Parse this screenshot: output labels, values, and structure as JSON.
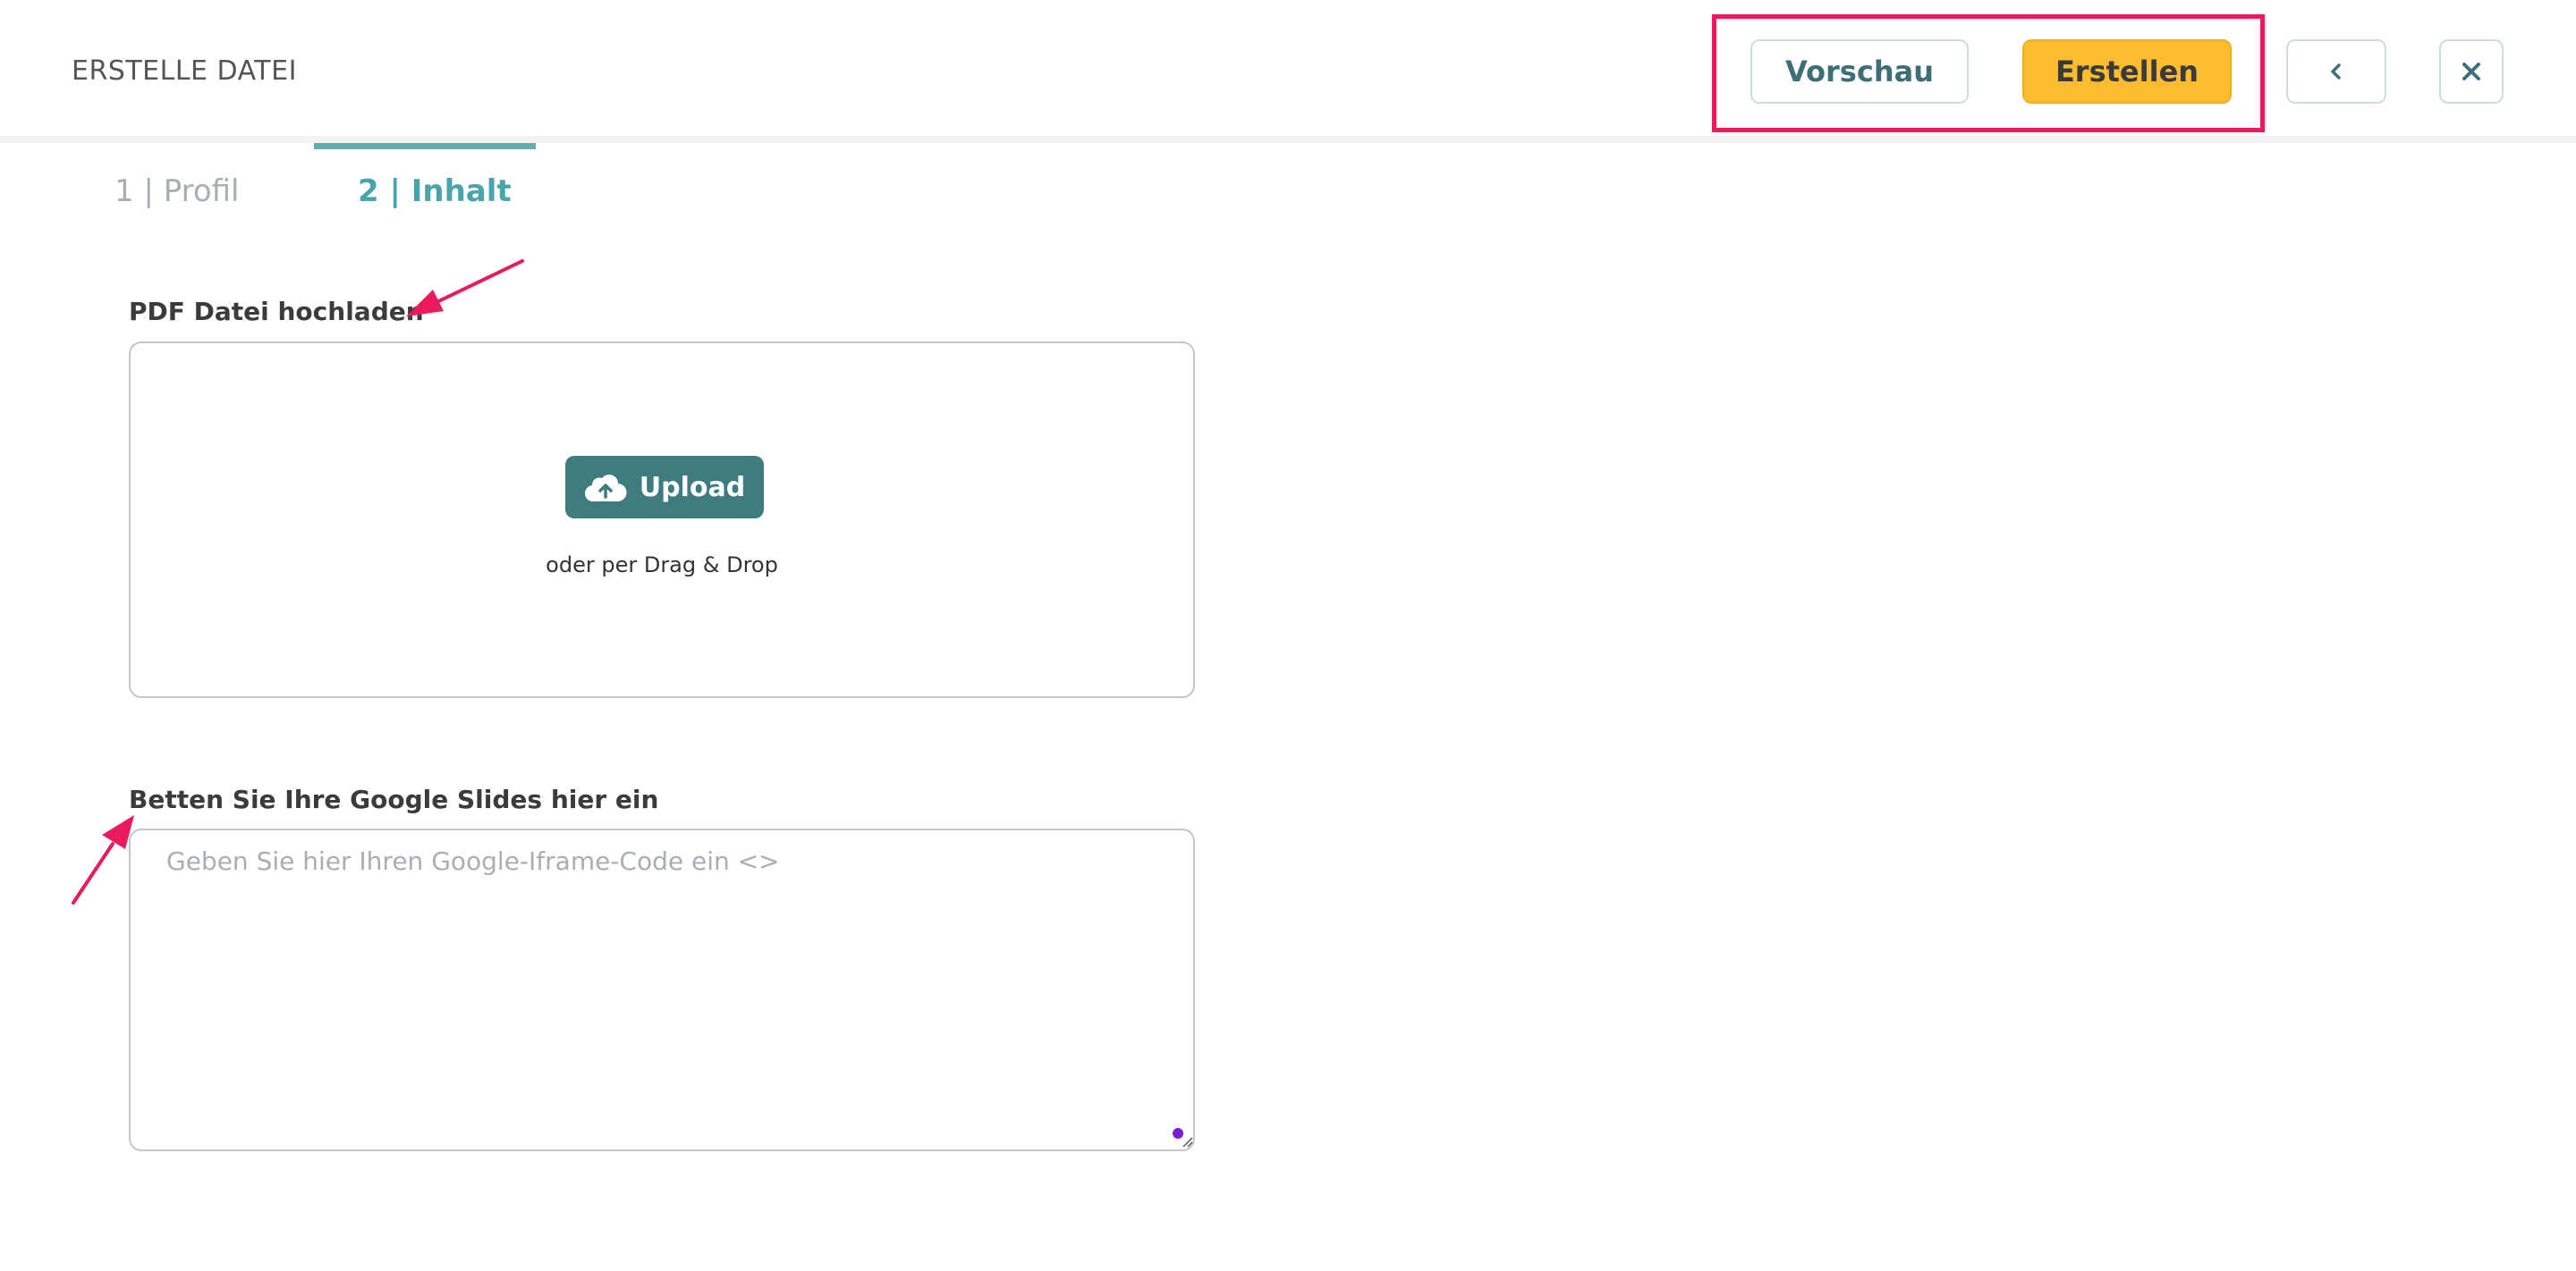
{
  "header": {
    "title": "ERSTELLE DATEI",
    "preview_label": "Vorschau",
    "create_label": "Erstellen",
    "back_icon": "chevron-left-icon",
    "close_icon": "close-icon"
  },
  "tabs": [
    {
      "label": "1 | Profil",
      "active": false
    },
    {
      "label": "2 | Inhalt",
      "active": true
    }
  ],
  "pdf_section": {
    "label": "PDF Datei hochladen",
    "upload_label": "Upload",
    "upload_icon": "cloud-upload-icon",
    "drop_hint": "oder per Drag & Drop"
  },
  "slides_section": {
    "label": "Betten Sie Ihre Google Slides hier ein",
    "placeholder": "Geben Sie hier Ihren Google-Iframe-Code ein <>",
    "value": ""
  },
  "colors": {
    "accent_teal": "#4aa4ab",
    "upload_button": "#3e7c80",
    "create_button": "#fbbd2f",
    "annotation": "#ea1a5b"
  }
}
